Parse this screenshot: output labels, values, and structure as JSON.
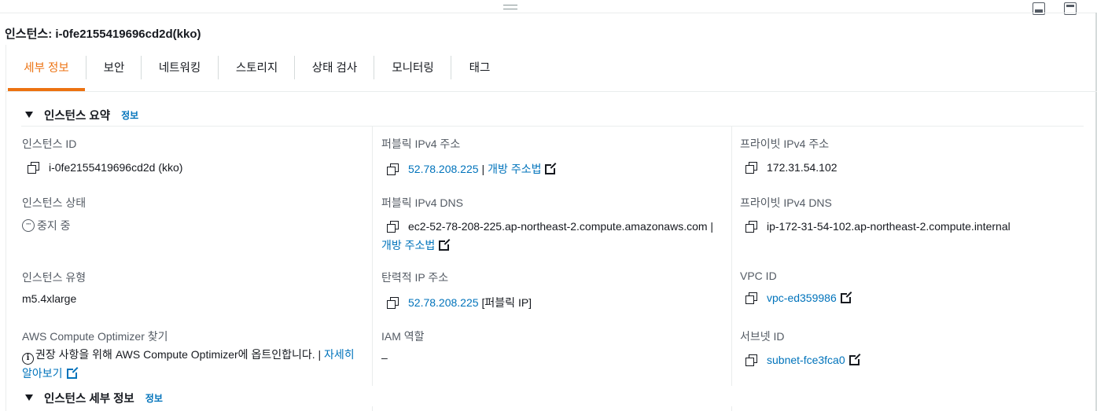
{
  "panel": {
    "title": "인스턴스: i-0fe2155419696cd2d(kko)"
  },
  "tabs": [
    {
      "label": "세부 정보",
      "active": true
    },
    {
      "label": "보안"
    },
    {
      "label": "네트워킹"
    },
    {
      "label": "스토리지"
    },
    {
      "label": "상태 검사"
    },
    {
      "label": "모니터링"
    },
    {
      "label": "태그"
    }
  ],
  "summary": {
    "heading": "인스턴스 요약",
    "info": "정보",
    "instance_id": {
      "label": "인스턴스 ID",
      "value": "i-0fe2155419696cd2d (kko)"
    },
    "public_ipv4": {
      "label": "퍼블릭 IPv4 주소",
      "ip": "52.78.208.225",
      "sep": "|",
      "open": "개방 주소법"
    },
    "private_ipv4": {
      "label": "프라이빗 IPv4 주소",
      "value": "172.31.54.102"
    },
    "instance_state": {
      "label": "인스턴스 상태",
      "value": "중지 중"
    },
    "public_dns": {
      "label": "퍼블릭 IPv4 DNS",
      "value": "ec2-52-78-208-225.ap-northeast-2.compute.amazonaws.com |",
      "open": "개방 주소법"
    },
    "private_dns": {
      "label": "프라이빗 IPv4 DNS",
      "value": "ip-172-31-54-102.ap-northeast-2.compute.internal"
    },
    "instance_type": {
      "label": "인스턴스 유형",
      "value": "m5.4xlarge"
    },
    "elastic_ip": {
      "label": "탄력적 IP 주소",
      "ip": "52.78.208.225",
      "suffix": "[퍼블릭 IP]"
    },
    "vpc_id": {
      "label": "VPC ID",
      "value": "vpc-ed359986"
    },
    "optimizer": {
      "label": "AWS Compute Optimizer 찾기",
      "text": "권장 사항을 위해 AWS Compute Optimizer에 옵트인합니다. | ",
      "link": "자세히 알아보기"
    },
    "iam_role": {
      "label": "IAM 역할",
      "value": "–"
    },
    "subnet_id": {
      "label": "서브넷 ID",
      "value": "subnet-fce3fca0"
    }
  },
  "details": {
    "heading": "인스턴스 세부 정보",
    "info": "정보"
  }
}
